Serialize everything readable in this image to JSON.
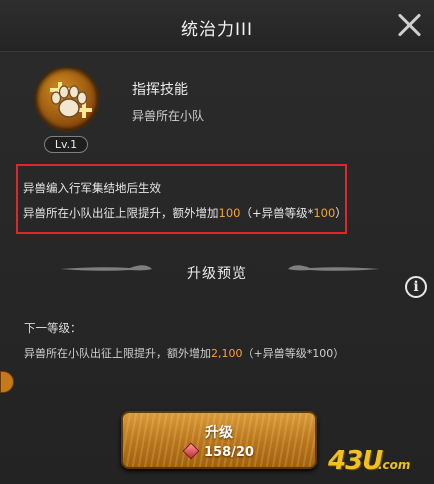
{
  "window": {
    "title": "统治力III"
  },
  "skill": {
    "icon": "paw-arrows-icon",
    "level": "Lv.1",
    "name": "指挥技能",
    "type": "异兽所在小队"
  },
  "effect": {
    "line1": "异兽编入行军集结地后生效",
    "line2_prefix": "异兽所在小队出征上限提升，额外增加",
    "line2_value": "100",
    "line2_mid": "（+异兽等级*",
    "line2_mult": "100",
    "line2_suffix": "）"
  },
  "preview": {
    "heading": "升级预览",
    "next_label": "下一等级：",
    "next_prefix": "异兽所在小队出征上限提升，额外增加",
    "next_value": "2,100",
    "next_suffix": "（+异兽等级*100）"
  },
  "upgrade_button": {
    "label": "升级",
    "cost": "158/20",
    "cost_icon": "gem-icon"
  },
  "watermark": {
    "main": "43U",
    "domain": ".com"
  },
  "colors": {
    "accent": "#f2a33a",
    "highlight_border": "#e0262b"
  }
}
